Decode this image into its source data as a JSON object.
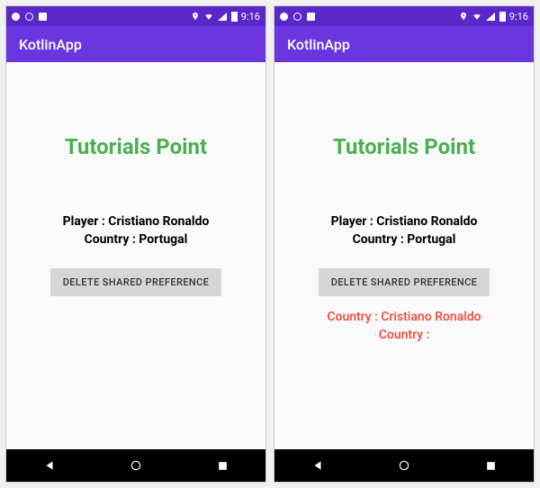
{
  "status": {
    "time": "9:16"
  },
  "appbar": {
    "title": "KotlinApp"
  },
  "main": {
    "heading": "Tutorials Point",
    "player_label": "Player : Cristiano Ronaldo",
    "country_label": "Country : Portugal",
    "button_label": "DELETE SHARED PREFERENCE"
  },
  "result": {
    "line1": "Country : Cristiano Ronaldo",
    "line2": "Country :"
  }
}
